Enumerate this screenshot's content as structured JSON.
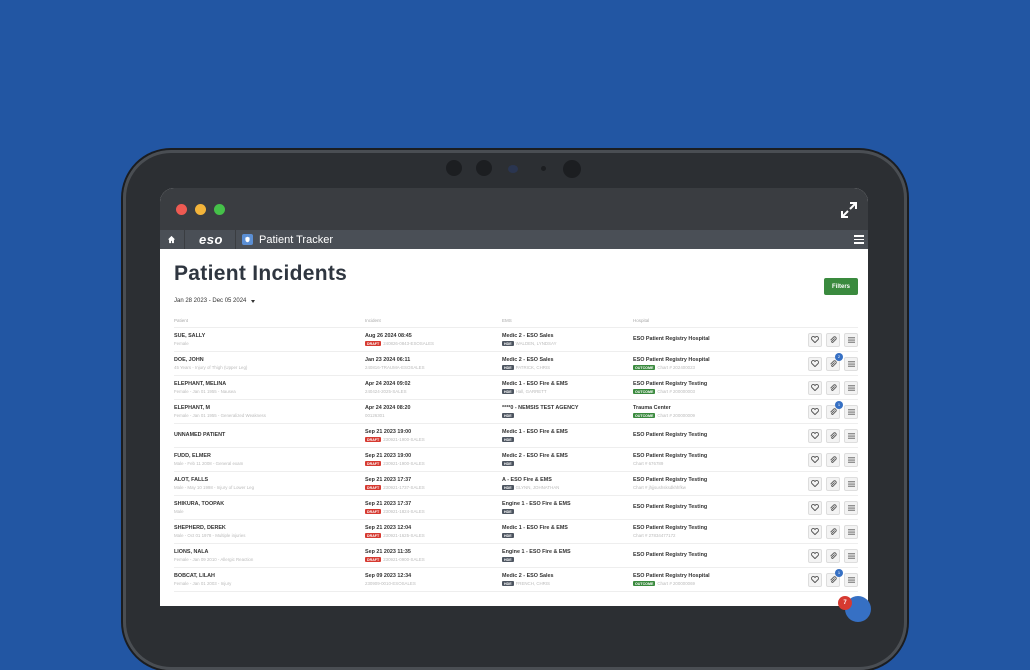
{
  "window": {
    "logo": "eso",
    "app_title": "Patient Tracker"
  },
  "page": {
    "title": "Patient Incidents",
    "filters_label": "Filters",
    "date_range": "Jan 28 2023 - Dec 05 2024"
  },
  "columns": [
    "Patient",
    "Incident",
    "EMS",
    "Hospital"
  ],
  "rows": [
    {
      "name": "SUE, SALLY",
      "desc": "Female",
      "date": "Aug 26 2024 08:45",
      "draft": true,
      "incident_id": "240826-0843-ESOSALES",
      "ems": "Medic 2 - ESO Sales",
      "crew": "WALDEN, LYNDSAY",
      "hospital": "ESO Patient Registry Hospital",
      "outcome": false,
      "chart": "",
      "badge": ""
    },
    {
      "name": "DOE, JOHN",
      "desc": "45 Years - Injury of Thigh (Upper Leg)",
      "date": "Jan 23 2024 06:11",
      "draft": false,
      "incident_id": "240816-TRAUMA-ESOSALES",
      "ems": "Medic 2 - ESO Sales",
      "crew": "PATRICK, CHRIS",
      "hospital": "ESO Patient Registry Hospital",
      "outcome": true,
      "chart": "Chart # 202400023",
      "badge": "2"
    },
    {
      "name": "ELEPHANT, MELINA",
      "desc": "Female - Jan 01 1955 - Nausea",
      "date": "Apr 24 2024 09:02",
      "draft": false,
      "incident_id": "240424-2025-SALES",
      "ems": "Medic 1 - ESO Fire & EMS",
      "crew": "Hall, GARRETT",
      "hospital": "ESO Patient Registry Testing",
      "outcome": true,
      "chart": "Chart # 200000003",
      "badge": ""
    },
    {
      "name": "ELEPHANT, M",
      "desc": "Female - Jan 01 1955 - Generalized Weakness",
      "date": "Apr 24 2024 08:20",
      "draft": false,
      "incident_id": "00126301",
      "ems": "****0 - NEMSIS TEST AGENCY",
      "crew": "",
      "hospital": "Trauma Center",
      "outcome": true,
      "chart": "Chart # 200000009",
      "badge": "1"
    },
    {
      "name": "UNNAMED PATIENT",
      "desc": "",
      "date": "Sep 21 2023 19:00",
      "draft": true,
      "incident_id": "230921-1900-SALES",
      "ems": "Medic 1 - ESO Fire & EMS",
      "crew": "",
      "hospital": "ESO Patient Registry Testing",
      "outcome": false,
      "chart": "",
      "badge": ""
    },
    {
      "name": "FUDD, ELMER",
      "desc": "Male - Feb 11 2008 - General exam",
      "date": "Sep 21 2023 19:00",
      "draft": true,
      "incident_id": "230921-1900-SALES",
      "ems": "Medic 2 - ESO Fire & EMS",
      "crew": "",
      "hospital": "ESO Patient Registry Testing",
      "outcome": false,
      "chart": "Chart # 676789",
      "badge": ""
    },
    {
      "name": "ALOT, FALLS",
      "desc": "Male - May 10 1998 - Injury of Lower Leg",
      "date": "Sep 21 2023 17:37",
      "draft": true,
      "incident_id": "230921-1737-SALES",
      "ems": "A - ESO Fire & EMS",
      "crew": "GLYNN, JOHNATHAN",
      "hospital": "ESO Patient Registry Testing",
      "outcome": false,
      "chart": "Chart # jhjjsushsksdkhhfkw",
      "badge": ""
    },
    {
      "name": "SHIKURA, TOOPAK",
      "desc": "Male",
      "date": "Sep 21 2023 17:37",
      "draft": true,
      "incident_id": "230921-1824-SALES",
      "ems": "Engine 1 - ESO Fire & EMS",
      "crew": "",
      "hospital": "ESO Patient Registry Testing",
      "outcome": false,
      "chart": "",
      "badge": ""
    },
    {
      "name": "SHEPHERD, DEREK",
      "desc": "Male - Oct 01 1978 - Multiple injuries",
      "date": "Sep 21 2023 12:04",
      "draft": true,
      "incident_id": "230921-1625-SALES",
      "ems": "Medic 1 - ESO Fire & EMS",
      "crew": "",
      "hospital": "ESO Patient Registry Testing",
      "outcome": false,
      "chart": "Chart # 27834477172",
      "badge": ""
    },
    {
      "name": "LIONS, NALA",
      "desc": "Female - Jan 09 2010 - Allergic Reaction",
      "date": "Sep 21 2023 11:35",
      "draft": true,
      "incident_id": "230921-0900-SALES",
      "ems": "Engine 1 - ESO Fire & EMS",
      "crew": "",
      "hospital": "ESO Patient Registry Testing",
      "outcome": false,
      "chart": "",
      "badge": ""
    },
    {
      "name": "BOBCAT, LILAH",
      "desc": "Female - Jan 01 2003 - Injury",
      "date": "Sep 09 2023 12:34",
      "draft": false,
      "incident_id": "230909-0010-ESOSALES",
      "ems": "Medic 2 - ESO Sales",
      "crew": "FRENCH, CHRIS",
      "hospital": "ESO Patient Registry Hospital",
      "outcome": true,
      "chart": "Chart # 200000069",
      "badge": "1"
    }
  ],
  "labels": {
    "draft": "DRAFT",
    "hde": "HDE",
    "outcome": "OUTCOME"
  },
  "notifications": {
    "count": "7"
  },
  "colors": {
    "background": "#2256a3",
    "accent_green": "#3a8a3e",
    "draft_red": "#d63a31",
    "badge_blue": "#3670c4"
  }
}
